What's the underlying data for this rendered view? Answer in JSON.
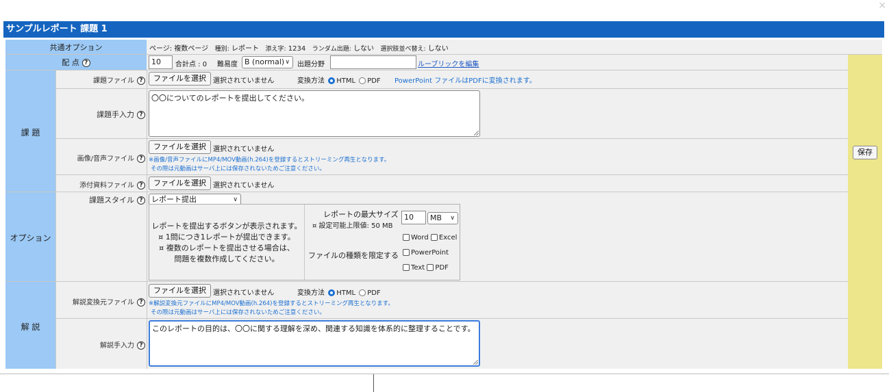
{
  "title": "サンプルレポート 課題 1",
  "close_glyph": "×",
  "common": {
    "label": "共通オプション",
    "page_key": "ページ:",
    "page_val": "複数ページ",
    "type_key": "種別:",
    "type_val": "レポート",
    "sub_key": "添え字:",
    "sub_val": "1234",
    "random_key": "ランダム出題:",
    "random_val": "しない",
    "shuffle_key": "選択肢並べ替え:",
    "shuffle_val": "しない"
  },
  "points": {
    "label": "配 点",
    "value": "10",
    "total": "合計点 : 0",
    "difficulty_label": "難易度",
    "difficulty_value": "B (normal)",
    "field_label": "出題分野",
    "field_value": "",
    "rubric_link": "ルーブリックを編集"
  },
  "assignment": {
    "section_label": "課 題",
    "file_label": "課題ファイル",
    "file_button": "ファイルを選択",
    "file_status": "選択されていません",
    "convert_label": "変換方法",
    "convert_html": "HTML",
    "convert_pdf": "PDF",
    "ppt_note": "PowerPoint ファイルはPDFに変換されます。",
    "input_label": "課題手入力",
    "input_text": "〇〇についてのレポートを提出してください。",
    "media_label": "画像/音声ファイル",
    "media_button": "ファイルを選択",
    "media_status": "選択されていません",
    "media_note1": "※画像/音声ファイルにMP4/MOV動画(h.264)を登録するとストリーミング再生となります。",
    "media_note2": "その際は元動画はサーバ上には保存されないためご注意ください。",
    "attach_label": "添付資料ファイル",
    "attach_button": "ファイルを選択",
    "attach_status": "選択されていません"
  },
  "options": {
    "section_label": "オプション",
    "style_label": "課題スタイル",
    "style_value": "レポート提出",
    "desc1": "レポートを提出するボタンが表示されます。",
    "desc2": "¤ 1問につき1レポートが提出できます。",
    "desc3": "¤ 複数のレポートを提出させる場合は、",
    "desc4": "問題を複数作成してください。",
    "max_size_label": "レポートの最大サイズ",
    "max_size_limit": "¤ 設定可能上限値: 50 MB",
    "max_size_value": "10",
    "max_size_unit": "MB",
    "filetype_label": "ファイルの種類を限定する",
    "ft_word": "Word",
    "ft_excel": "Excel",
    "ft_ppt": "PowerPoint",
    "ft_text": "Text",
    "ft_pdf": "PDF"
  },
  "explanation": {
    "section_label": "解 説",
    "file_label": "解説変換元ファイル",
    "file_button": "ファイルを選択",
    "file_status": "選択されていません",
    "convert_label": "変換方法",
    "convert_html": "HTML",
    "convert_pdf": "PDF",
    "note1": "※解説変換元ファイルにMP4/MOV動画(h.264)を登録するとストリーミング再生となります。",
    "note2": "その際は元動画はサーバ上には保存されないためご注意ください。",
    "input_label": "解説手入力",
    "input_text": "このレポートの目的は、〇〇に関する理解を深め、関連する知識を体系的に整理することです。"
  },
  "save_button": "保存",
  "help_glyph": "?",
  "colors": {
    "title_bar": "#1565c0",
    "label_blue": "#9cc9f5",
    "save_column": "#ede68b",
    "link": "#1a56c4"
  }
}
